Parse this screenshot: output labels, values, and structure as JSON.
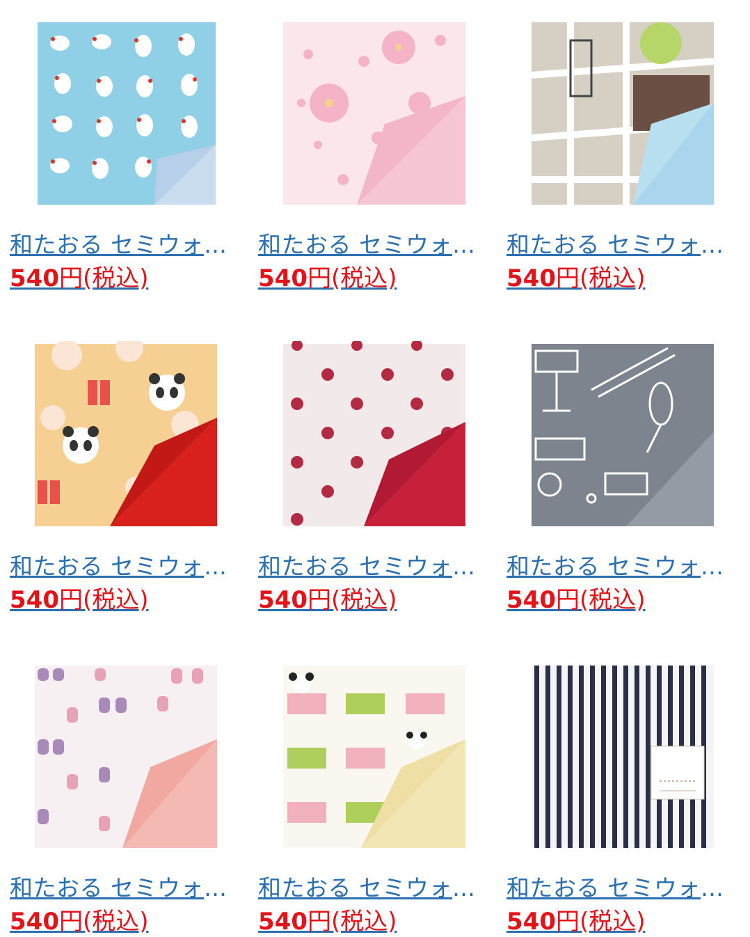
{
  "products": [
    {
      "title": "和たおる セミウォッシュタオル",
      "price": "540",
      "currency": "円",
      "tax": "(税込)",
      "image": "bird-pattern-towel",
      "colors": {
        "bg": "#8fcde3",
        "accent": "#b9d9ee"
      }
    },
    {
      "title": "和たおる セミウォッシュタオル",
      "price": "540",
      "currency": "円",
      "tax": "(税込)",
      "image": "sakura-pattern-towel",
      "colors": {
        "bg": "#fbe3ea",
        "accent": "#f4bdd0"
      }
    },
    {
      "title": "和たおる セミウォッシュタオル",
      "price": "540",
      "currency": "円",
      "tax": "(税込)",
      "image": "city-map-towel",
      "colors": {
        "bg": "#d8d2c6",
        "accent": "#a9d6ec"
      }
    },
    {
      "title": "和たおる セミウォッシュタオル",
      "price": "540",
      "currency": "円",
      "tax": "(税込)",
      "image": "panda-towel",
      "colors": {
        "bg": "#f6cf92",
        "accent": "#d8201d"
      }
    },
    {
      "title": "和たおる セミウォッシュタオル",
      "price": "540",
      "currency": "円",
      "tax": "(税込)",
      "image": "polka-dot-towel",
      "colors": {
        "bg": "#f1e7e8",
        "accent": "#c7203a"
      }
    },
    {
      "title": "和たおる セミウォッシュタオル",
      "price": "540",
      "currency": "円",
      "tax": "(税込)",
      "image": "music-instrument-towel",
      "colors": {
        "bg": "#7e858e",
        "accent": "#9aa0a8"
      }
    },
    {
      "title": "和たおる セミウォッシュタオル",
      "price": "540",
      "currency": "円",
      "tax": "(税込)",
      "image": "owl-pattern-towel",
      "colors": {
        "bg": "#f5eff1",
        "accent": "#f4b9b2"
      }
    },
    {
      "title": "和たおる セミウォッシュタオル",
      "price": "540",
      "currency": "円",
      "tax": "(税込)",
      "image": "panda-block-towel",
      "colors": {
        "bg": "#faf7f1",
        "accent": "#f3e6b5"
      }
    },
    {
      "title": "和たおる セミウォッシュタオル",
      "price": "540",
      "currency": "円",
      "tax": "(税込)",
      "image": "stripe-towel",
      "colors": {
        "bg": "#f4f4f6",
        "accent": "#2b2f46"
      }
    }
  ]
}
